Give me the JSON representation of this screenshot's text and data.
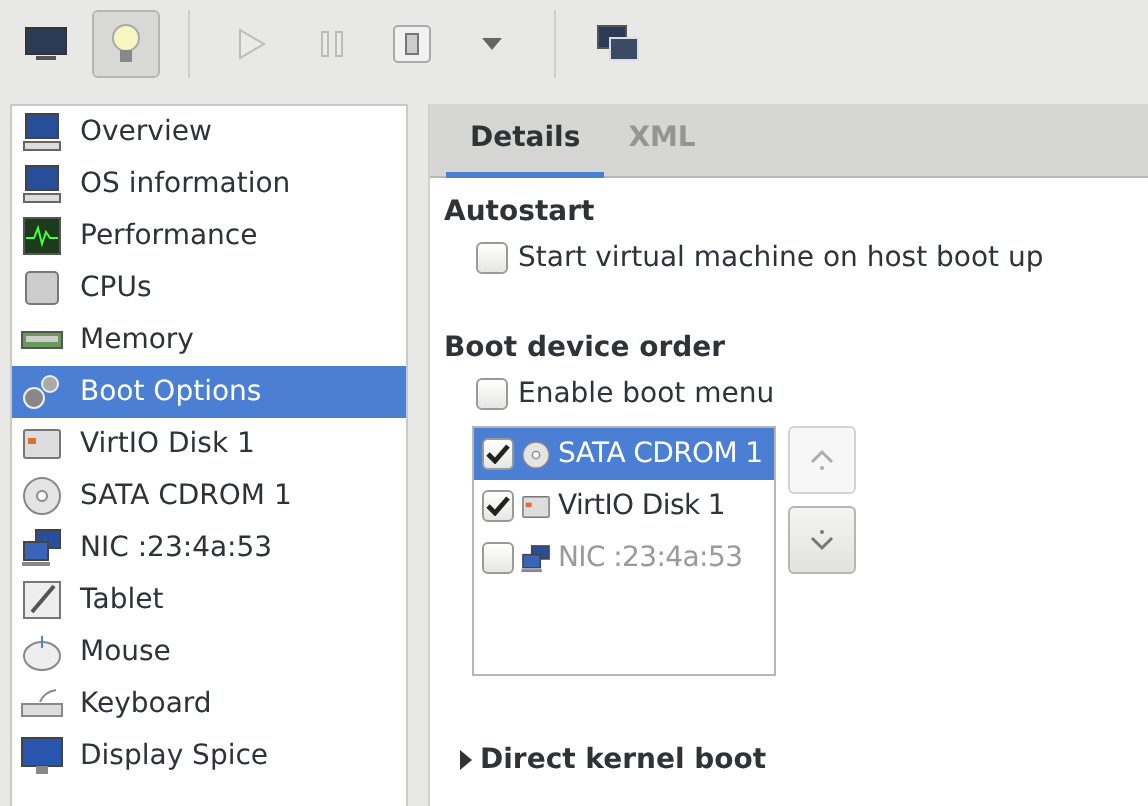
{
  "toolbar": [
    {
      "kind": "console",
      "selected": false,
      "disabled": false
    },
    {
      "kind": "details",
      "selected": true,
      "disabled": false
    },
    {
      "kind": "separator"
    },
    {
      "kind": "play",
      "selected": false,
      "disabled": true
    },
    {
      "kind": "pause",
      "selected": false,
      "disabled": true
    },
    {
      "kind": "shutdown",
      "selected": false,
      "disabled": false
    },
    {
      "kind": "dropdown",
      "selected": false,
      "disabled": false
    },
    {
      "kind": "separator"
    },
    {
      "kind": "fullscreen",
      "selected": false,
      "disabled": false
    }
  ],
  "sidebar": {
    "items": [
      {
        "label": "Overview",
        "kind": "computer",
        "selected": false
      },
      {
        "label": "OS information",
        "kind": "computer",
        "selected": false
      },
      {
        "label": "Performance",
        "kind": "graph",
        "selected": false
      },
      {
        "label": "CPUs",
        "kind": "chip",
        "selected": false
      },
      {
        "label": "Memory",
        "kind": "ram",
        "selected": false
      },
      {
        "label": "Boot Options",
        "kind": "gears",
        "selected": true
      },
      {
        "label": "VirtIO Disk 1",
        "kind": "disk",
        "selected": false
      },
      {
        "label": "SATA CDROM 1",
        "kind": "cd",
        "selected": false
      },
      {
        "label": "NIC :23:4a:53",
        "kind": "network",
        "selected": false
      },
      {
        "label": "Tablet",
        "kind": "tablet",
        "selected": false
      },
      {
        "label": "Mouse",
        "kind": "mouse",
        "selected": false
      },
      {
        "label": "Keyboard",
        "kind": "keyboard",
        "selected": false
      },
      {
        "label": "Display Spice",
        "kind": "display",
        "selected": false
      }
    ]
  },
  "tabs": [
    {
      "label": "Details",
      "selected": true
    },
    {
      "label": "XML",
      "selected": false
    }
  ],
  "autostart": {
    "heading": "Autostart",
    "checkbox": {
      "label": "Start virtual machine on host boot up",
      "checked": false
    }
  },
  "boot_order": {
    "heading": "Boot device order",
    "menu_checkbox": {
      "label": "Enable boot menu",
      "checked": false
    },
    "devices": [
      {
        "label": "SATA CDROM 1",
        "kind": "cd",
        "checked": true,
        "selected": true
      },
      {
        "label": "VirtIO Disk 1",
        "kind": "disk",
        "checked": true,
        "selected": false
      },
      {
        "label": "NIC :23:4a:53",
        "kind": "network",
        "checked": false,
        "selected": false
      }
    ],
    "move_up": {
      "disabled": true
    },
    "move_down": {
      "disabled": false
    }
  },
  "kernel_boot": {
    "label": "Direct kernel boot",
    "expanded": false
  }
}
